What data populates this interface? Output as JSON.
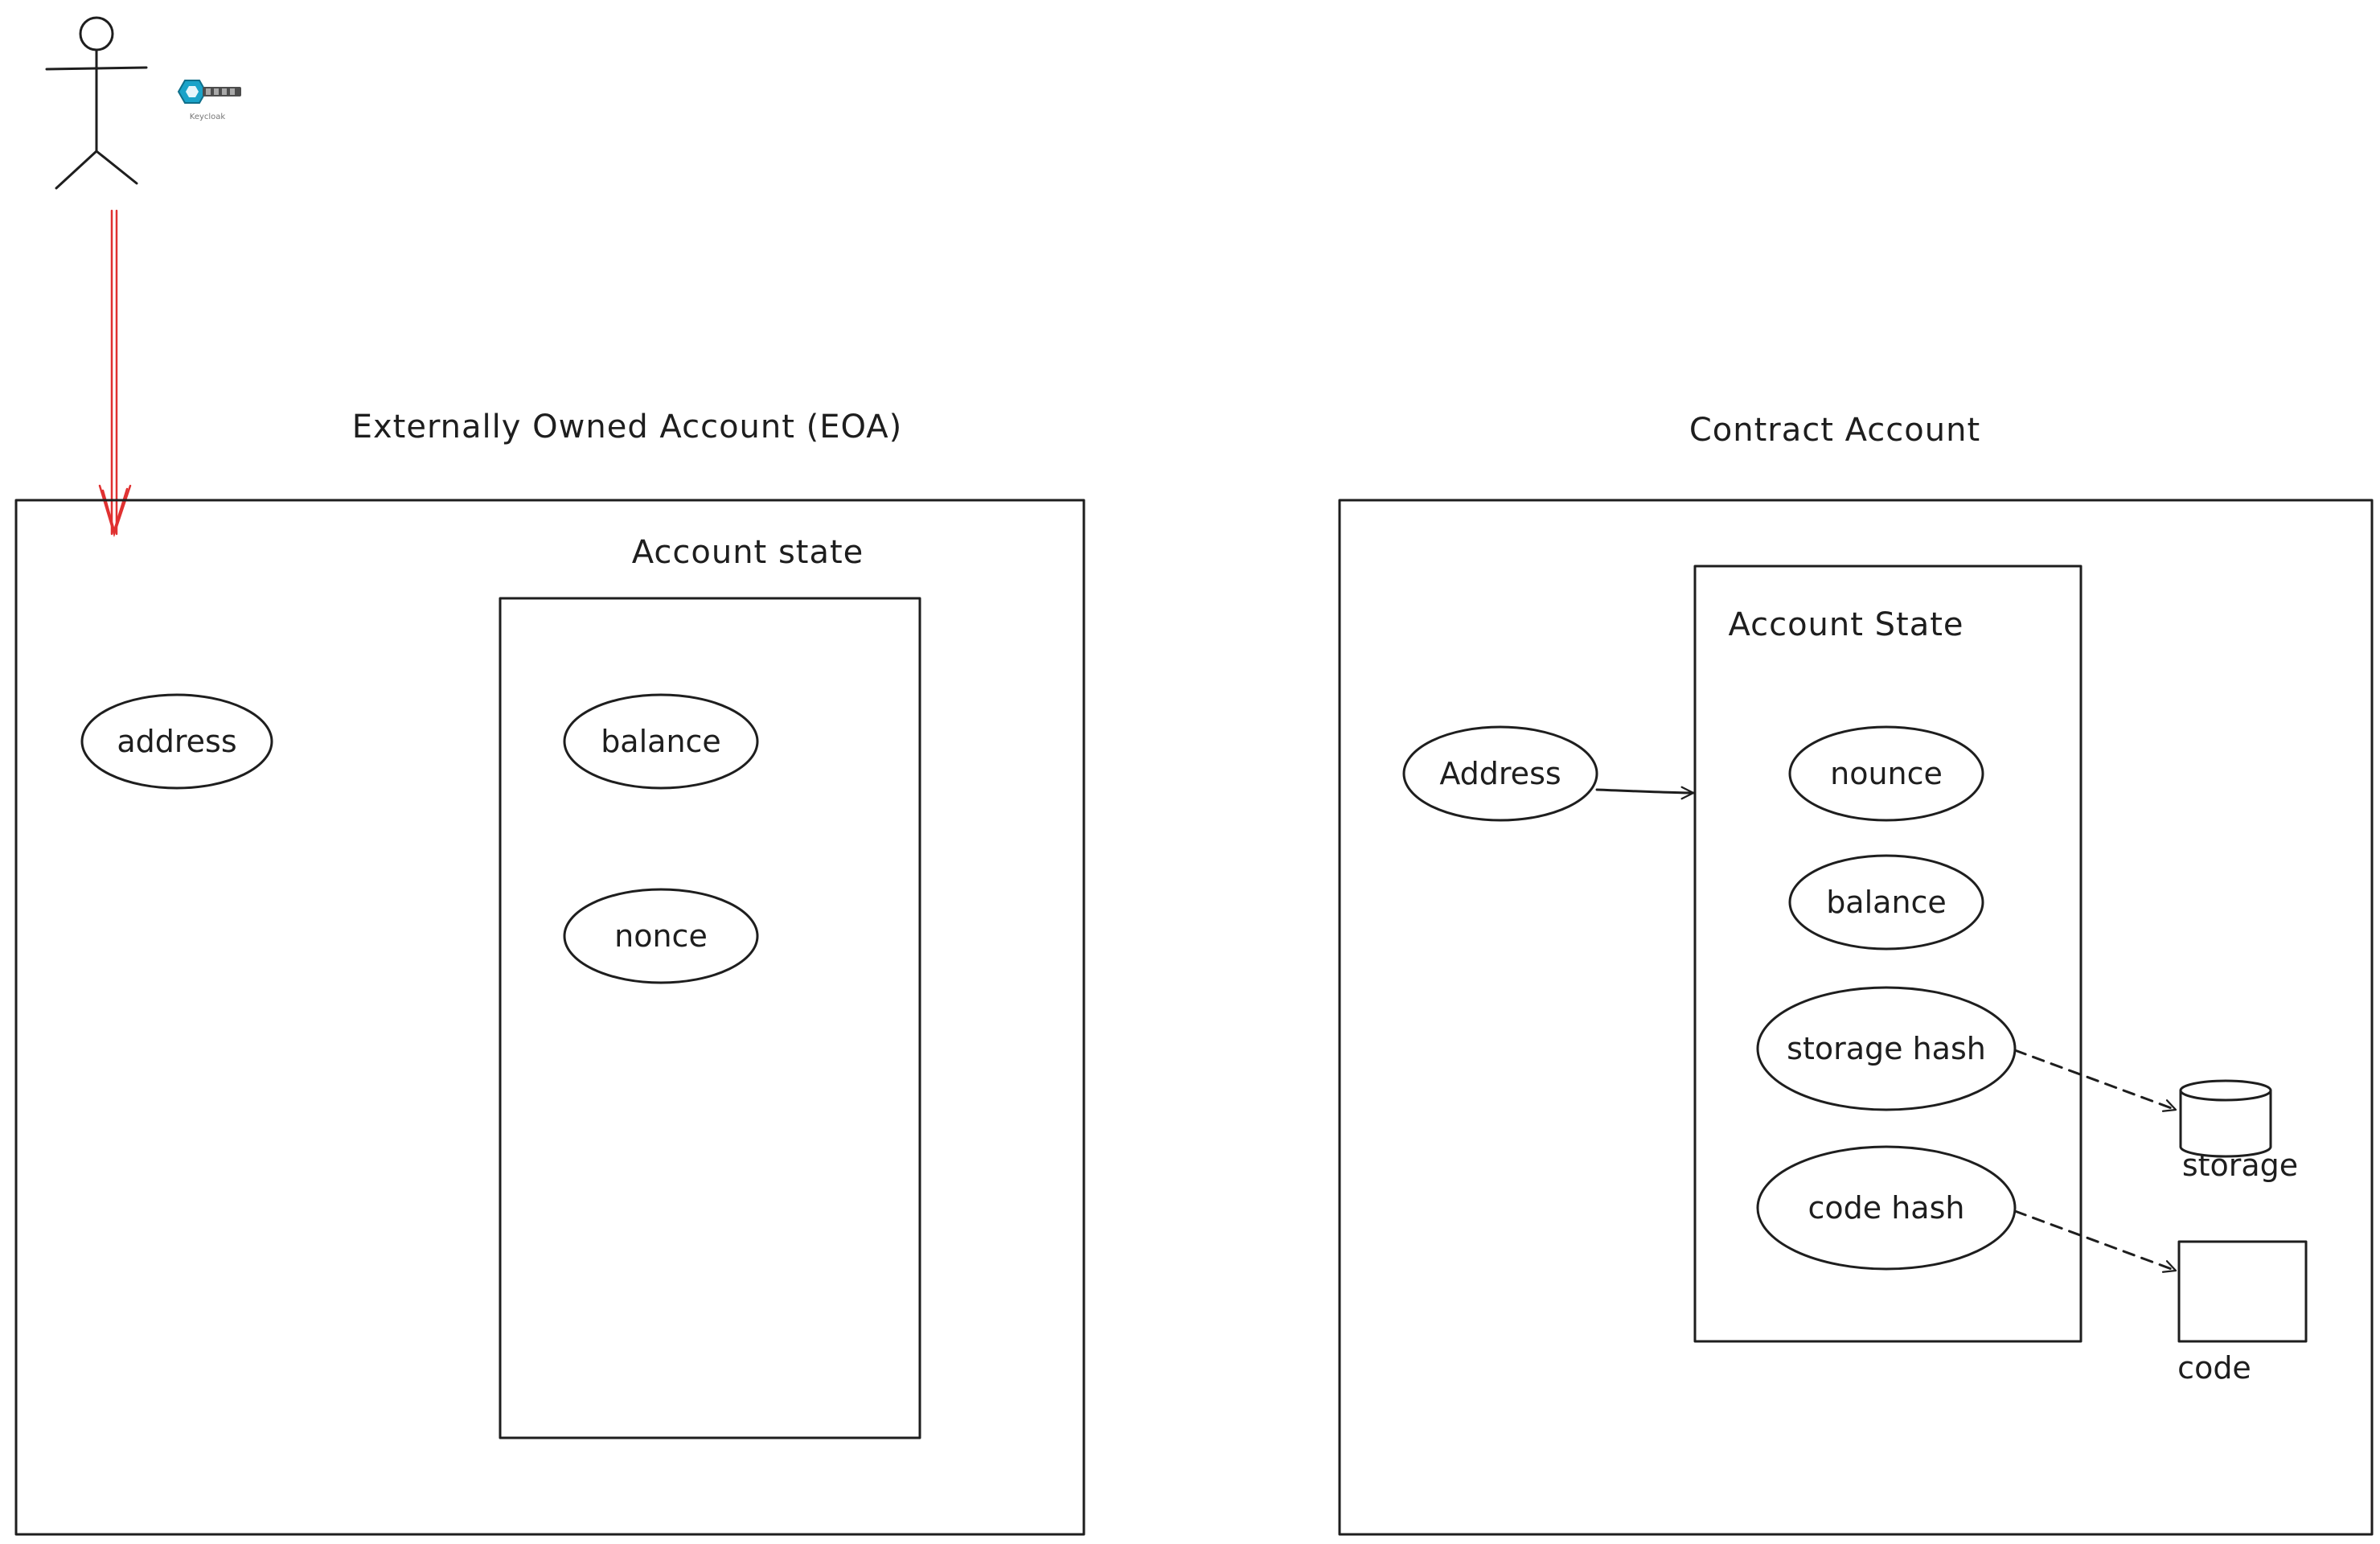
{
  "colors": {
    "ink": "#1e1e1e",
    "arrow_red": "#e03131",
    "key_icon": "#1aa3c9",
    "background": "#ffffff"
  },
  "actor": {
    "icon": "stick-figure-icon"
  },
  "key_logo": {
    "icon": "keycloak-logo-icon",
    "caption": "Keycloak"
  },
  "eoa": {
    "title": "Externally Owned Account (EOA)",
    "address_label": "address",
    "account_state": {
      "title": "Account state",
      "items": [
        "balance",
        "nonce"
      ]
    }
  },
  "contract": {
    "title": "Contract Account",
    "address_label": "Address",
    "account_state": {
      "title": "Account State",
      "items": [
        "nounce",
        "balance",
        "storage hash",
        "code hash"
      ]
    },
    "storage_label": "storage",
    "code_label": "code"
  }
}
